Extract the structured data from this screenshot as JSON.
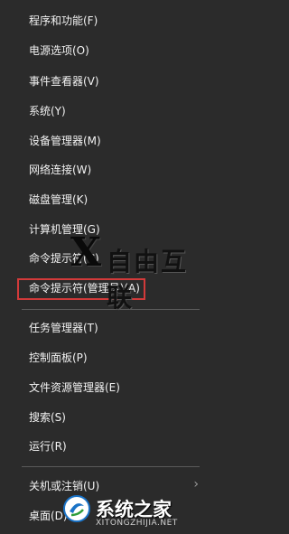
{
  "menu": {
    "items": [
      {
        "label": "程序和功能(F)"
      },
      {
        "label": "电源选项(O)"
      },
      {
        "label": "事件查看器(V)"
      },
      {
        "label": "系统(Y)"
      },
      {
        "label": "设备管理器(M)"
      },
      {
        "label": "网络连接(W)"
      },
      {
        "label": "磁盘管理(K)"
      },
      {
        "label": "计算机管理(G)"
      },
      {
        "label": "命令提示符(C)"
      },
      {
        "label": "命令提示符(管理员)(A)"
      },
      {
        "label": "任务管理器(T)"
      },
      {
        "label": "控制面板(P)"
      },
      {
        "label": "文件资源管理器(E)"
      },
      {
        "label": "搜索(S)"
      },
      {
        "label": "运行(R)"
      },
      {
        "label": "关机或注销(U)"
      },
      {
        "label": "桌面(D)"
      }
    ],
    "highlighted_index": 9,
    "submenu_chevron": "›"
  },
  "watermark": {
    "mark": "X",
    "text": "自由互联"
  },
  "logo": {
    "name": "系统之家",
    "url": "XITONGZHIJIA.NET"
  },
  "colors": {
    "background": "#2b2b2b",
    "text": "#f2f2f2",
    "separator": "#5a5a5a",
    "highlight_border": "#d23a3a"
  }
}
